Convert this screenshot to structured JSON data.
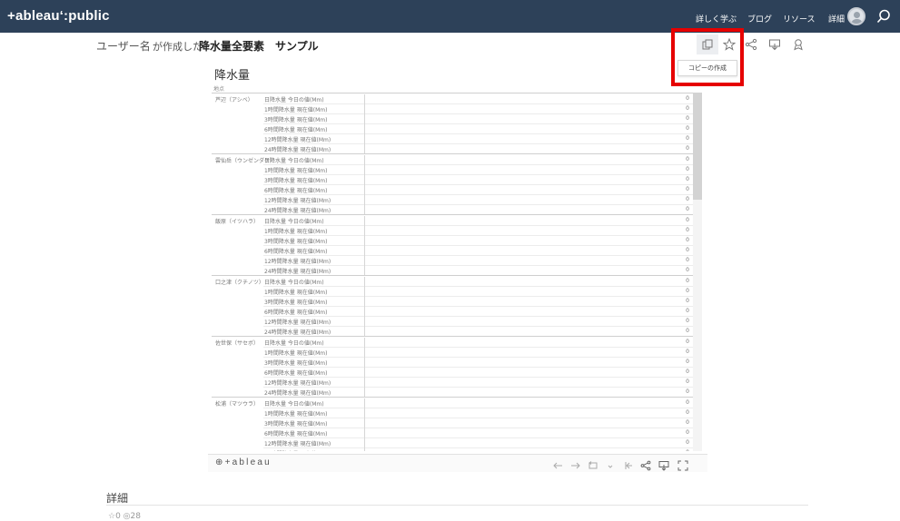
{
  "header": {
    "logo": "+ableau‘:public",
    "nav": [
      "詳しく学ぶ",
      "ブログ",
      "リソース",
      "詳細"
    ]
  },
  "viz": {
    "author": "ユーザー名",
    "created_by": "が作成した",
    "title": "降水量全要素　サンプル",
    "copy_popup": "コピーの作成",
    "heading": "降水量",
    "column_header": "地点",
    "sites": [
      {
        "name": "芦辺（アシベ）"
      },
      {
        "name": "雲仙岳（ウンゼンダケ）"
      },
      {
        "name": "飯原（イツハラ）"
      },
      {
        "name": "口之津（クチノツ）"
      },
      {
        "name": "佐世保（サセボ）"
      },
      {
        "name": "松浦（マツウラ）"
      }
    ],
    "metrics": [
      "日降水量 今日の値(Mm)",
      "1時間降水量 現在値(Mm)",
      "3時間降水量 現在値(Mm)",
      "6時間降水量 現在値(Mm)",
      "12時間降水量 現在値(Mm)",
      "24時間降水量 現在値(Mm)"
    ],
    "value": "0",
    "footer_logo": "⊕+ableau"
  },
  "details": {
    "heading": "詳細",
    "stats": "☆0 ◎28"
  },
  "colors": {
    "nav_bg": "#2d4159",
    "highlight": "#e60000"
  }
}
